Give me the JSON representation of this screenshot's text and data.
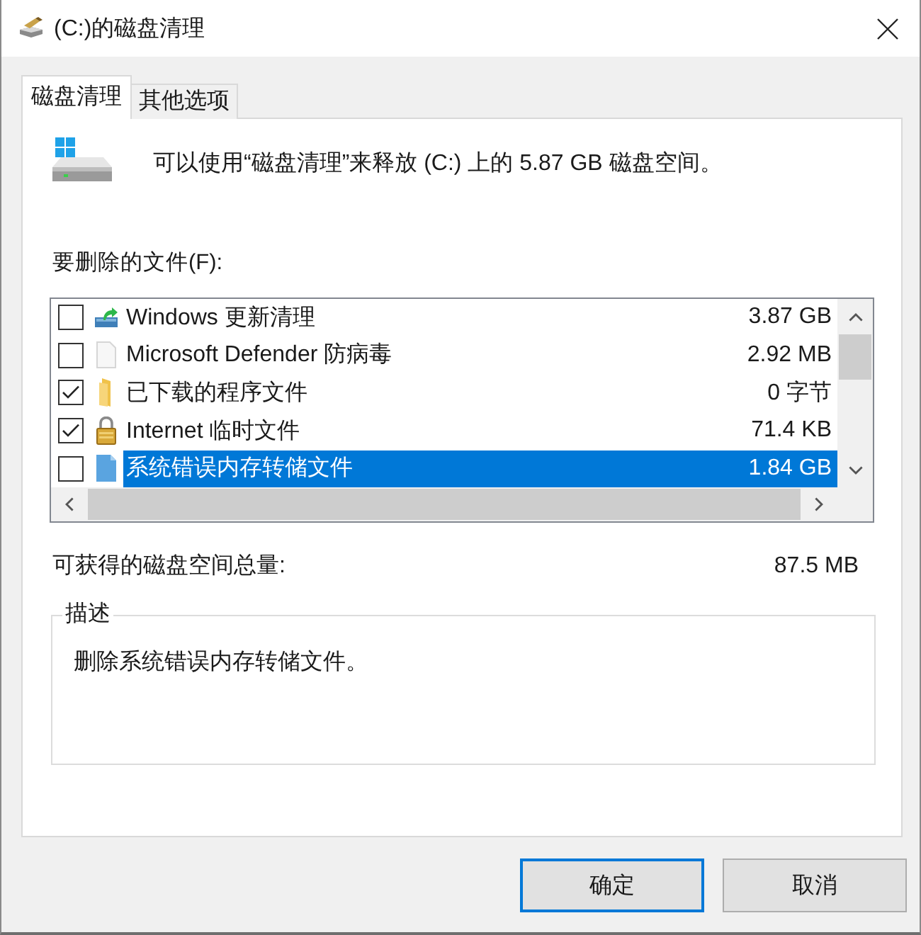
{
  "window": {
    "title": "(C:)的磁盘清理"
  },
  "tabs": [
    {
      "label": "磁盘清理",
      "selected": true
    },
    {
      "label": "其他选项",
      "selected": false
    }
  ],
  "intro": {
    "text": "可以使用“磁盘清理”来释放 (C:) 上的 5.87 GB 磁盘空间。"
  },
  "files": {
    "label": "要删除的文件(F):",
    "items": [
      {
        "name": "Windows 更新清理",
        "size": "3.87 GB",
        "checked": false,
        "selected": false
      },
      {
        "name": "Microsoft Defender 防病毒",
        "size": "2.92 MB",
        "checked": false,
        "selected": false
      },
      {
        "name": "已下载的程序文件",
        "size": "0 字节",
        "checked": true,
        "selected": false
      },
      {
        "name": "Internet 临时文件",
        "size": "71.4 KB",
        "checked": true,
        "selected": false
      },
      {
        "name": "系统错误内存转储文件",
        "size": "1.84 GB",
        "checked": false,
        "selected": true
      }
    ]
  },
  "total": {
    "label": "可获得的磁盘空间总量:",
    "value": "87.5 MB"
  },
  "description": {
    "legend": "描述",
    "text": "删除系统错误内存转储文件。"
  },
  "buttons": [
    {
      "label": "确定",
      "default": true
    },
    {
      "label": "取消",
      "default": false
    }
  ]
}
